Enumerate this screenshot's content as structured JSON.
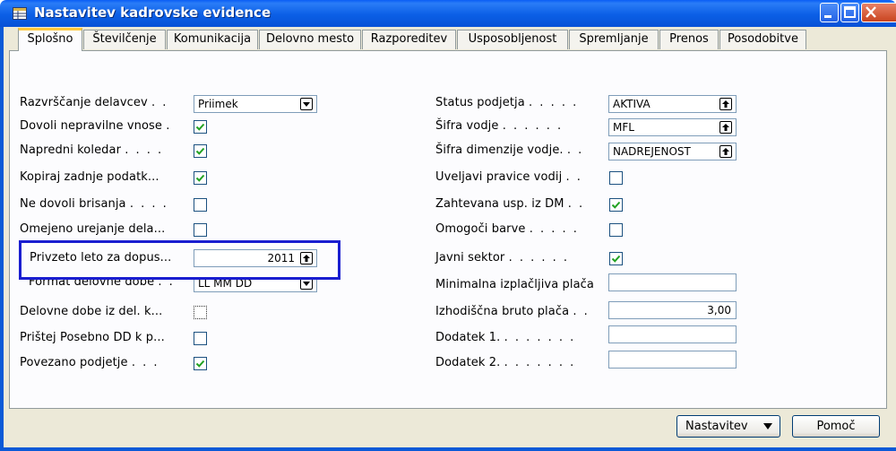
{
  "window": {
    "title": "Nastavitev kadrovske evidence"
  },
  "tabs": [
    {
      "label": "Splošno",
      "active": true
    },
    {
      "label": "Številčenje"
    },
    {
      "label": "Komunikacija"
    },
    {
      "label": "Delovno mesto"
    },
    {
      "label": "Razporeditev"
    },
    {
      "label": "Usposobljenost"
    },
    {
      "label": "Spremljanje"
    },
    {
      "label": "Prenos"
    },
    {
      "label": "Posodobitve"
    }
  ],
  "left_fields": {
    "razvrscanje": {
      "label": "Razvrščanje delavcev",
      "dots": ". .",
      "value": "Priimek"
    },
    "dovoli_nepravilne": {
      "label": "Dovoli nepravilne vnose",
      "dots": ".",
      "checked": true
    },
    "napredni_koledar": {
      "label": "Napredni koledar",
      "dots": ". . . .",
      "checked": true
    },
    "kopiraj_zadnje": {
      "label": "Kopiraj zadnje podatk...",
      "checked": true
    },
    "ne_dovoli_brisanja": {
      "label": "Ne dovoli brisanja",
      "dots": ". . . .",
      "checked": false
    },
    "omejeno_urejanje": {
      "label": "Omejeno urejanje dela...",
      "checked": false
    },
    "privzeto_leto": {
      "label": "Privzeto leto za dopus...",
      "value": "2011"
    },
    "format_delovne_dobe": {
      "label": "Format delovne dobe",
      "dots": ". .",
      "value": "LL MM DD"
    },
    "delovne_dobe_iz_del": {
      "label": "Delovne dobe iz del. k...",
      "checked": false
    },
    "pristej_posebno": {
      "label": "Prištej Posebno DD k p...",
      "checked": false
    },
    "povezano_podjetje": {
      "label": "Povezano podjetje",
      "dots": ". . .",
      "checked": true
    }
  },
  "right_fields": {
    "status_podjetja": {
      "label": "Status podjetja",
      "dots": ". . . . .",
      "value": "AKTIVA"
    },
    "sifra_vodje": {
      "label": "Šifra vodje",
      "dots": ". . . . . .",
      "value": "MFL"
    },
    "sifra_dimenzije_vodje": {
      "label": "Šifra dimenzije vodje.",
      "dots": ". .",
      "value": "NADREJENOST"
    },
    "uveljavi_pravice": {
      "label": "Uveljavi pravice vodij",
      "dots": ". .",
      "checked": false
    },
    "zahtevana_usp": {
      "label": "Zahtevana usp. iz DM",
      "dots": ". .",
      "checked": true
    },
    "omogoci_barve": {
      "label": "Omogoči barve",
      "dots": ". . . . .",
      "checked": false
    },
    "javni_sektor": {
      "label": "Javni sektor",
      "dots": ". . . . . .",
      "checked": true
    },
    "minimalna_placa": {
      "label": "Minimalna izplačljiva plača",
      "value": ""
    },
    "izhodiscna_bruto": {
      "label": "Izhodiščna bruto plača",
      "dots": ". .",
      "value": "3,00"
    },
    "dodatek1": {
      "label": "Dodatek 1.",
      "dots": ". . . . . . .",
      "value": ""
    },
    "dodatek2": {
      "label": "Dodatek 2.",
      "dots": ". . . . . . .",
      "value": ""
    }
  },
  "buttons": {
    "nastavitev": "Nastavitev",
    "pomoc": "Pomoč"
  },
  "icons": {
    "app": "table-icon",
    "dropdown": "dropdown-arrow-icon",
    "lookup": "lookup-arrow-icon",
    "check": "checkmark-icon"
  },
  "colors": {
    "titlebar": "#0b5fe6",
    "highlight": "#1a1ed0",
    "check": "#21a121"
  }
}
